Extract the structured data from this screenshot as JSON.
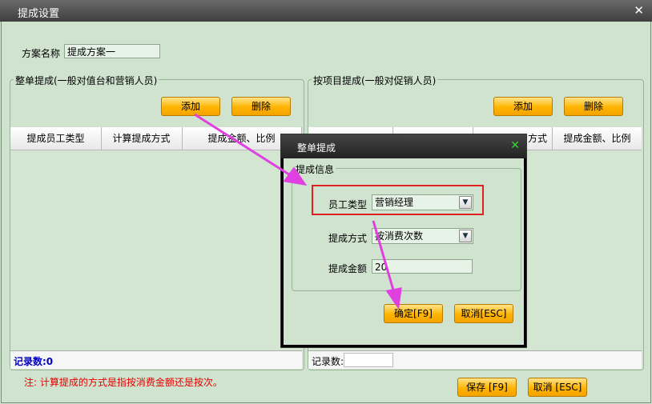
{
  "window": {
    "title": "提成设置",
    "close_glyph": "✕"
  },
  "scheme": {
    "label": "方案名称",
    "value": "提成方案一"
  },
  "left_group": {
    "title": "整单提成(一般对值台和营销人员)",
    "add_label": "添加",
    "delete_label": "删除",
    "columns": [
      "提成员工类型",
      "计算提成方式",
      "提成金额、比例"
    ],
    "record_label": "记录数:0"
  },
  "right_group": {
    "title": "按项目提成(一般对促销人员)",
    "add_label": "添加",
    "delete_label": "删除",
    "columns": [
      "",
      "",
      "方式",
      "提成金额、比例"
    ],
    "record_label": "记录数:0"
  },
  "note": "注: 计算提成的方式是指按消费金额还是按次。",
  "save_label": "保存 [F9]",
  "cancel_label": "取消 [ESC]",
  "dialog": {
    "title": "整单提成",
    "close_glyph": "✕",
    "group_title": "提成信息",
    "employee_type_label": "员工类型",
    "employee_type_value": "营销经理",
    "method_label": "提成方式",
    "method_value": "按消费次数",
    "amount_label": "提成金额",
    "amount_value": "20",
    "ok_label": "确定[F9]",
    "cancel_label": "取消[ESC]"
  },
  "colors": {
    "annotation_arrow": "#e040e0",
    "highlight_box": "#e02020",
    "accent_button": "#ffb400"
  }
}
